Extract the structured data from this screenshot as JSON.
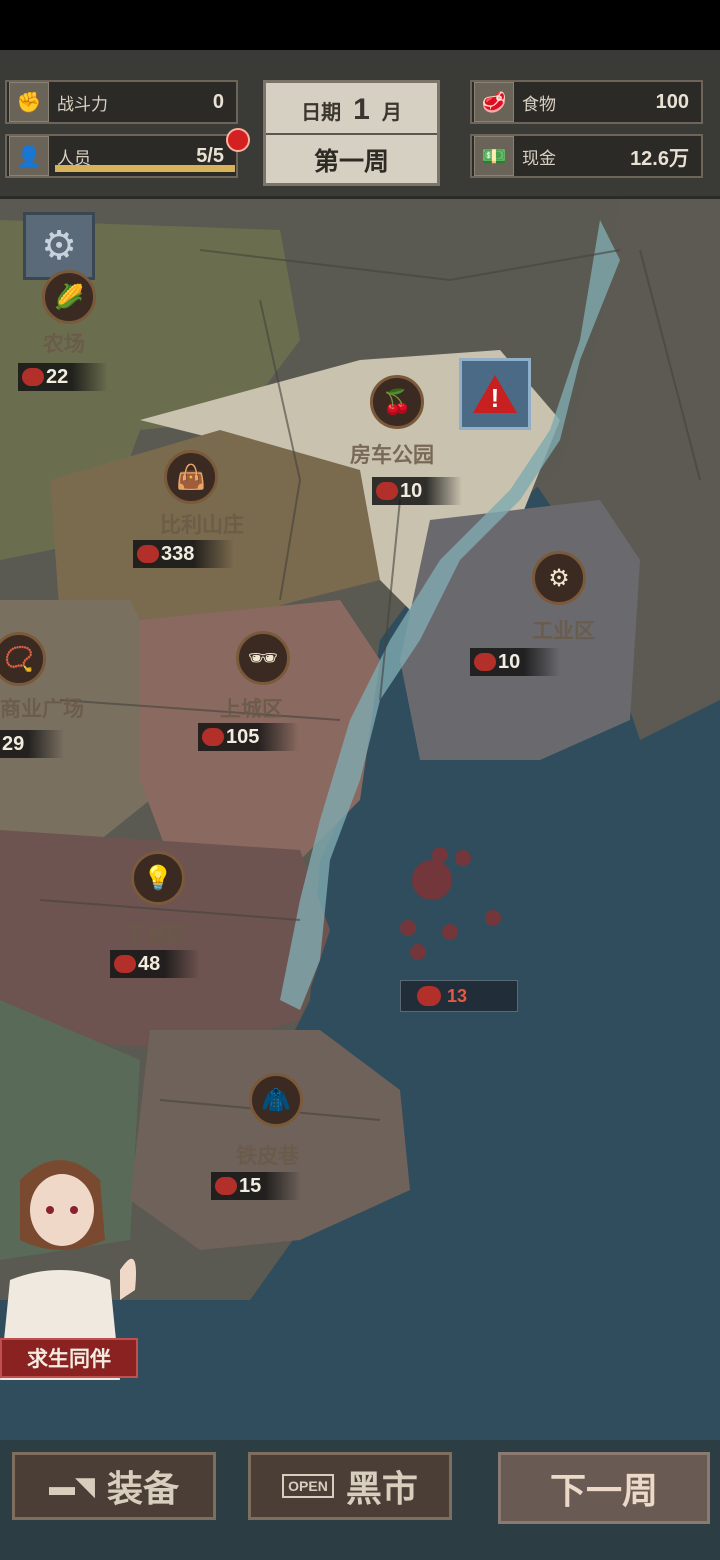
{
  "stats": {
    "combat": {
      "label": "战斗力",
      "value": "0"
    },
    "people": {
      "label": "人员",
      "value": "5/5",
      "fill_fraction": 1.0
    },
    "food": {
      "label": "食物",
      "value": "100"
    },
    "cash": {
      "label": "现金",
      "value": "12.6万"
    }
  },
  "date": {
    "label": "日期",
    "month_num": "1",
    "month_unit": "月",
    "week": "第一周"
  },
  "map": {
    "nodes": [
      {
        "name": "农场",
        "power": "22"
      },
      {
        "name": "房车公园",
        "power": "10"
      },
      {
        "name": "比利山庄",
        "power": "338"
      },
      {
        "name": "工业区",
        "power": "10"
      },
      {
        "name": "商业广场",
        "power": "29"
      },
      {
        "name": "上城区",
        "power": "105"
      },
      {
        "name": "下城区",
        "power": "48"
      },
      {
        "name": "铁皮巷",
        "power": "15"
      }
    ],
    "enemy_power": "13"
  },
  "companion": {
    "label": "求生同伴"
  },
  "bottom": {
    "equipment": "装备",
    "black_market": "黑市",
    "open_sign": "OPEN",
    "next_week": "下一周"
  },
  "colors": {
    "enemy": "#b3302a",
    "alert": "#c82020"
  }
}
